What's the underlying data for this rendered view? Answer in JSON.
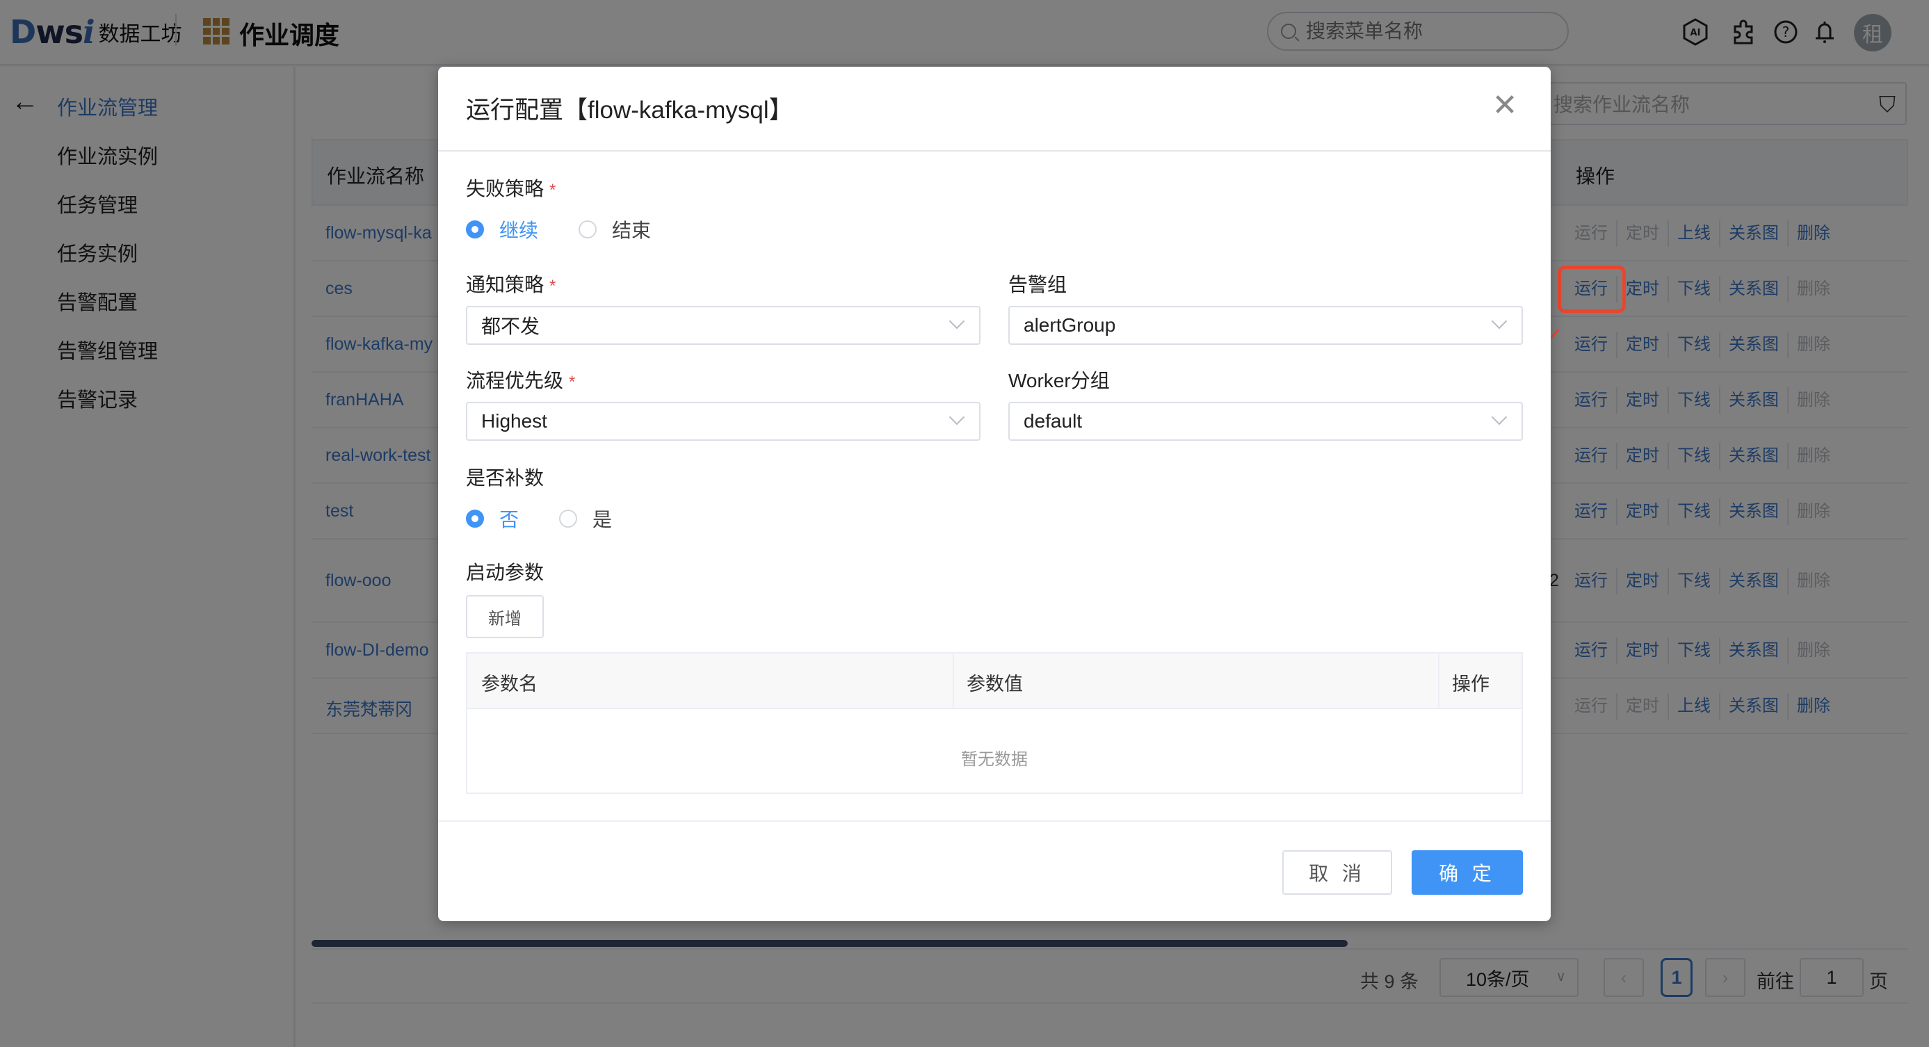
{
  "header": {
    "logo_brand": "Dwsi",
    "logo_text": "数据工坊",
    "app_title": "作业调度",
    "menu_search_placeholder": "搜索菜单名称",
    "icons": [
      "ai-icon",
      "plugin-icon",
      "help-icon",
      "bell-icon"
    ],
    "avatar_text": "租"
  },
  "sidebar": {
    "items": [
      {
        "label": "作业流管理",
        "active": true
      },
      {
        "label": "作业流实例",
        "active": false
      },
      {
        "label": "任务管理",
        "active": false
      },
      {
        "label": "任务实例",
        "active": false
      },
      {
        "label": "告警配置",
        "active": false
      },
      {
        "label": "告警组管理",
        "active": false
      },
      {
        "label": "告警记录",
        "active": false
      }
    ]
  },
  "list": {
    "search_placeholder": "搜索作业流名称",
    "columns": {
      "name": "作业流名称",
      "ops": "操作"
    },
    "rows": [
      {
        "name": "flow-mysql-ka",
        "extra": "",
        "ops": [
          {
            "label": "运行",
            "enabled": false
          },
          {
            "label": "定时",
            "enabled": false
          },
          {
            "label": "上线",
            "enabled": true
          },
          {
            "label": "关系图",
            "enabled": true
          },
          {
            "label": "删除",
            "enabled": true
          }
        ]
      },
      {
        "name": "ces",
        "extra": "",
        "ops": [
          {
            "label": "运行",
            "enabled": true
          },
          {
            "label": "定时",
            "enabled": true
          },
          {
            "label": "下线",
            "enabled": true
          },
          {
            "label": "关系图",
            "enabled": true
          },
          {
            "label": "删除",
            "enabled": false
          }
        ]
      },
      {
        "name": "flow-kafka-my",
        "extra": "",
        "ops": [
          {
            "label": "运行",
            "enabled": true
          },
          {
            "label": "定时",
            "enabled": true
          },
          {
            "label": "下线",
            "enabled": true
          },
          {
            "label": "关系图",
            "enabled": true
          },
          {
            "label": "删除",
            "enabled": false
          }
        ]
      },
      {
        "name": "franHAHA",
        "extra": "",
        "ops": [
          {
            "label": "运行",
            "enabled": true
          },
          {
            "label": "定时",
            "enabled": true
          },
          {
            "label": "下线",
            "enabled": true
          },
          {
            "label": "关系图",
            "enabled": true
          },
          {
            "label": "删除",
            "enabled": false
          }
        ]
      },
      {
        "name": "real-work-test",
        "extra": "",
        "ops": [
          {
            "label": "运行",
            "enabled": true
          },
          {
            "label": "定时",
            "enabled": true
          },
          {
            "label": "下线",
            "enabled": true
          },
          {
            "label": "关系图",
            "enabled": true
          },
          {
            "label": "删除",
            "enabled": false
          }
        ]
      },
      {
        "name": "test",
        "extra": "",
        "ops": [
          {
            "label": "运行",
            "enabled": true
          },
          {
            "label": "定时",
            "enabled": true
          },
          {
            "label": "下线",
            "enabled": true
          },
          {
            "label": "关系图",
            "enabled": true
          },
          {
            "label": "删除",
            "enabled": false
          }
        ]
      },
      {
        "name": "flow-ooo",
        "extra": "2",
        "ops": [
          {
            "label": "运行",
            "enabled": true
          },
          {
            "label": "定时",
            "enabled": true
          },
          {
            "label": "下线",
            "enabled": true
          },
          {
            "label": "关系图",
            "enabled": true
          },
          {
            "label": "删除",
            "enabled": false
          }
        ]
      },
      {
        "name": "flow-DI-demo",
        "extra": "",
        "ops": [
          {
            "label": "运行",
            "enabled": true
          },
          {
            "label": "定时",
            "enabled": true
          },
          {
            "label": "下线",
            "enabled": true
          },
          {
            "label": "关系图",
            "enabled": true
          },
          {
            "label": "删除",
            "enabled": false
          }
        ]
      },
      {
        "name": "东莞梵蒂冈",
        "extra": "",
        "ops": [
          {
            "label": "运行",
            "enabled": false
          },
          {
            "label": "定时",
            "enabled": false
          },
          {
            "label": "上线",
            "enabled": true
          },
          {
            "label": "关系图",
            "enabled": true
          },
          {
            "label": "删除",
            "enabled": true
          }
        ]
      }
    ]
  },
  "pagination": {
    "total": "共 9 条",
    "page_size": "10条/页",
    "prev": "‹",
    "current": "1",
    "next": "›",
    "goto_label": "前往",
    "goto_value": "1",
    "page_label": "页"
  },
  "modal": {
    "title": "运行配置【flow-kafka-mysql】",
    "close_icon": "close-icon",
    "failure_strategy": {
      "label": "失败策略",
      "required": "*",
      "options": [
        {
          "label": "继续",
          "checked": true
        },
        {
          "label": "结束",
          "checked": false
        }
      ]
    },
    "notify_strategy": {
      "label": "通知策略",
      "required": "*",
      "value": "都不发"
    },
    "alert_group": {
      "label": "告警组",
      "value": "alertGroup"
    },
    "priority": {
      "label": "流程优先级",
      "required": "*",
      "value": "Highest"
    },
    "worker_group": {
      "label": "Worker分组",
      "value": "default"
    },
    "backfill": {
      "label": "是否补数",
      "options": [
        {
          "label": "否",
          "checked": true
        },
        {
          "label": "是",
          "checked": false
        }
      ]
    },
    "start_params": {
      "label": "启动参数",
      "add_button": "新增",
      "columns": [
        "参数名",
        "参数值",
        "操作"
      ],
      "empty_text": "暂无数据"
    },
    "cancel_button": "取 消",
    "ok_button": "确 定"
  },
  "colors": {
    "primary": "#4094f5",
    "link": "#3b76c9",
    "annotation": "#e8472e",
    "required": "#e34b4b"
  }
}
